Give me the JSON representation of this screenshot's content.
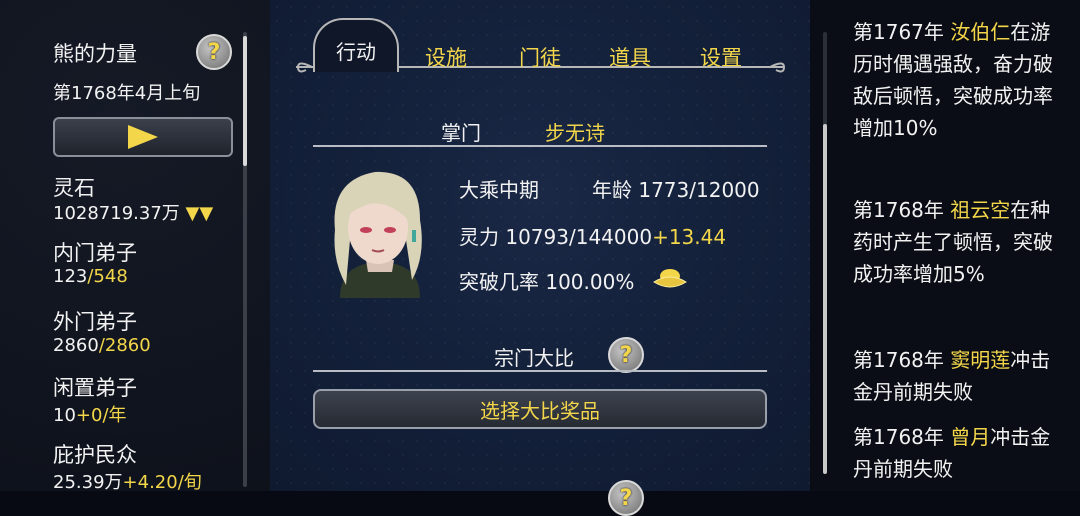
{
  "sect": {
    "name": "熊的力量",
    "date": "第1768年4月上旬"
  },
  "resources": [
    {
      "label": "灵石",
      "value": "1028719.37万",
      "suffix": "▼▼"
    },
    {
      "label": "内门弟子",
      "value": "123",
      "suffix": "/548"
    },
    {
      "label": "外门弟子",
      "value": "2860",
      "suffix": "/2860"
    },
    {
      "label": "闲置弟子",
      "value": "10",
      "suffix": "+0/年"
    },
    {
      "label": "庇护民众",
      "value": "25.39万",
      "suffix": "+4.20/旬"
    }
  ],
  "tabs": {
    "active": "行动",
    "others": [
      "设施",
      "门徒",
      "道具",
      "设置"
    ]
  },
  "leader": {
    "title_label": "掌门",
    "name": "步无诗",
    "realm": "大乘中期",
    "age_label": "年龄",
    "age": "1773/12000",
    "spirit_label": "灵力",
    "spirit": "10793/144000",
    "spirit_rate": "+13.44",
    "breakthrough_label": "突破几率",
    "breakthrough": "100.00%"
  },
  "competition": {
    "label": "宗门大比",
    "button": "选择大比奖品"
  },
  "logs": [
    {
      "year": "第1767年",
      "name": "汝伯仁",
      "text": "在游历时偶遇强敌，奋力破敌后顿悟，突破成功率增加10%"
    },
    {
      "year": "第1768年",
      "name": "祖云空",
      "text": "在种药时产生了顿悟，突破成功率增加5%"
    },
    {
      "year": "第1768年",
      "name": "窦明莲",
      "text": "冲击金丹前期失败"
    },
    {
      "year": "第1768年",
      "name": "曾月",
      "text": "冲击金丹前期失败"
    }
  ]
}
